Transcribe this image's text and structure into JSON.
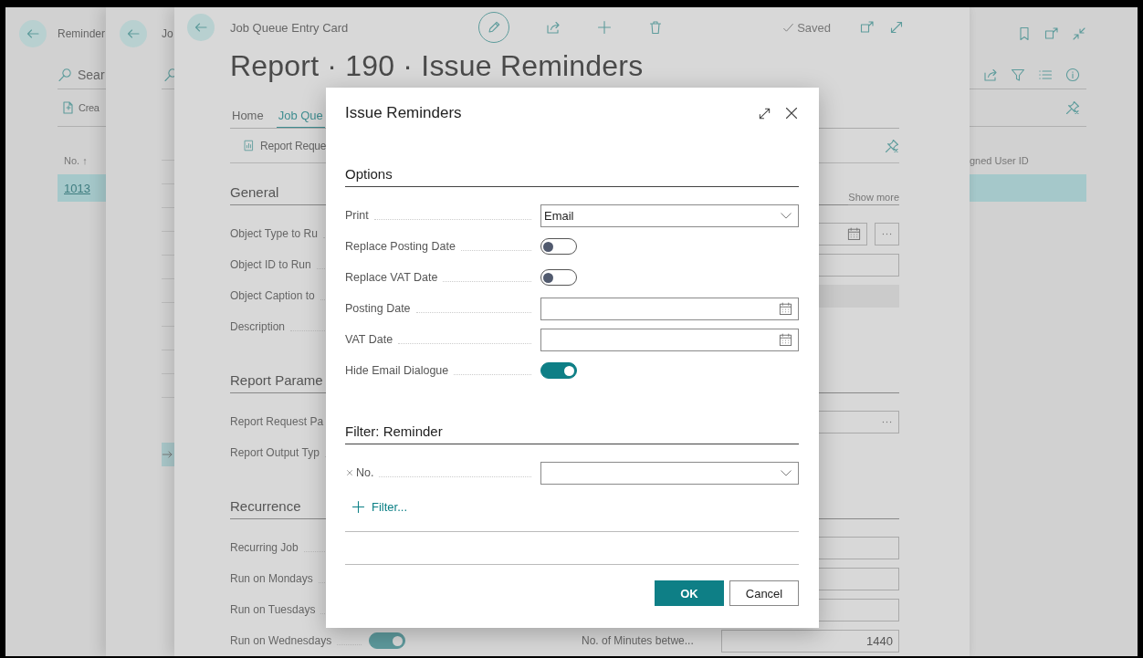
{
  "reminders_list": {
    "title": "Reminder",
    "search": "Sear",
    "action": "Crea",
    "columns": [
      "No. ↑",
      "gned User ID"
    ],
    "rows": [
      {
        "no": "1013",
        "selected": true
      }
    ]
  },
  "job_queue_list": {
    "title": "Jo"
  },
  "entry_card": {
    "breadcrumb": "Job Queue Entry Card",
    "status": "Saved",
    "title": "Report · 190 · Issue Reminders",
    "tabs": [
      {
        "label": "Home",
        "selected": false
      },
      {
        "label": "Job Que",
        "selected": true
      }
    ],
    "action": "Report Reque",
    "sections": [
      {
        "title": "General",
        "show_more": "Show more",
        "rows": [
          {
            "label": "Object Type to Ru",
            "second": {
              "kind": "date"
            }
          },
          {
            "label": "Object ID to Run",
            "second": {
              "kind": "text"
            }
          },
          {
            "label": "Object Caption to",
            "second": {
              "kind": "readonly"
            }
          },
          {
            "label": "Description"
          }
        ]
      },
      {
        "title": "Report Parame",
        "rows": [
          {
            "label": "Report Request Pa",
            "second": {
              "kind": "lookup"
            }
          },
          {
            "label": "Report Output Typ"
          }
        ]
      },
      {
        "title": "Recurrence",
        "rows": [
          {
            "label": "Recurring Job",
            "second": {
              "kind": "text"
            }
          },
          {
            "label": "Run on Mondays",
            "second": {
              "kind": "text"
            }
          },
          {
            "label": "Run on Tuesdays",
            "second": {
              "kind": "text"
            }
          },
          {
            "label": "Run on Wednesdays",
            "toggle": {
              "on": true
            },
            "second": {
              "kind": "text",
              "label": "No. of Minutes betwe...",
              "value": "1440"
            }
          }
        ]
      }
    ]
  },
  "dialog": {
    "title": "Issue Reminders",
    "sections": [
      {
        "title": "Options",
        "rows": [
          {
            "label": "Print",
            "kind": "select",
            "value": "Email"
          },
          {
            "label": "Replace Posting Date",
            "kind": "toggle",
            "on": false
          },
          {
            "label": "Replace VAT Date",
            "kind": "toggle",
            "on": false
          },
          {
            "label": "Posting Date",
            "kind": "date"
          },
          {
            "label": "VAT Date",
            "kind": "date"
          },
          {
            "label": "Hide Email Dialogue",
            "kind": "toggle",
            "on": true
          }
        ]
      },
      {
        "title": "Filter: Reminder",
        "rows": [
          {
            "label": "No.",
            "kind": "filter"
          }
        ]
      }
    ],
    "add_filter": "Filter...",
    "buttons": [
      {
        "label": "OK",
        "primary": true
      },
      {
        "label": "Cancel",
        "primary": false
      }
    ]
  }
}
